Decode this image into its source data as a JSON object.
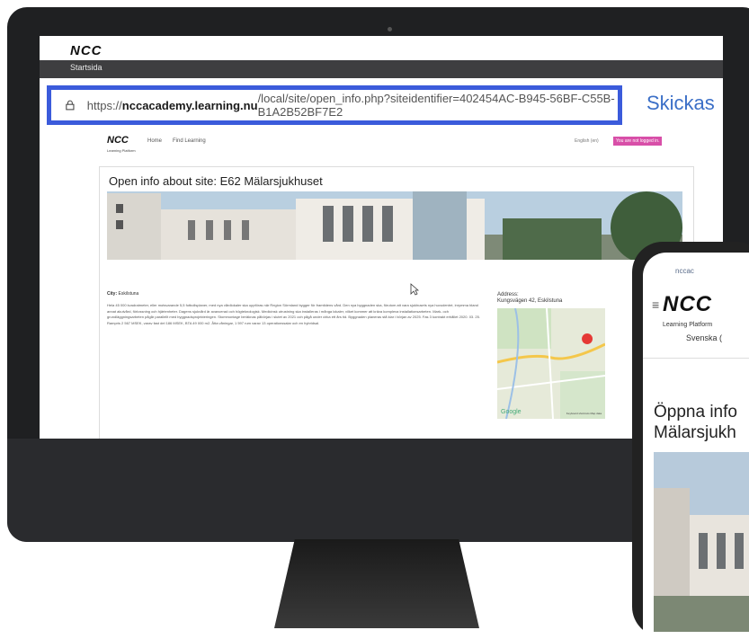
{
  "monitor": {
    "topbar": {
      "logo": "NCC",
      "home_label": "Startsida"
    },
    "url": {
      "prefix": "https://",
      "domain": "nccacademy.learning.nu",
      "path": "/local/site/open_info.php?siteidentifier=402454AC-B945-56BF-C55B-B1A2B52BF7E2"
    },
    "skickas": "Skickas",
    "site_header": {
      "logo": "NCC",
      "logo_sub": "Learning Platform",
      "nav": [
        "Home",
        "Find Learning"
      ],
      "language": "English (en)",
      "login_status": "You are not logged in."
    },
    "page": {
      "title": "Open info about site: E62 Mälarsjukhuset",
      "city_label": "City:",
      "city_value": "Eskilstuna",
      "description": "Hela 45 000 kvadratmeter, eller motsvarande 5,5 fotbollsplaner, med nya vårdlokaler ska uppföras när Region Sörmland bygger för framtidens vård. Den nya byggnaden ska, förutom att vara sjukhusets nya huvudentré, inrymma bland annat akutvård, förlossning och hjärtenheter. Dagens sjukvård är avancerad och högteknologisk. Medicinsk utrustning ska installeras i många lokaler, vilket kommer att kräva komplexa installationsarbeten. Mark- och grundläggningsarbeten pågår parallellt med byggnadsprojekteringen. Stommontage beräknas påbörjas i slutet av 2021 och pågå under cirka ett års tid. Byggnaden planeras stå klar i början av 2025. Fas 3 kontrakt erhållet 2020. 03. 25. Rampris 2 567 MSEK, varav fast del 186 MSEK, BTA 49 000 m2. Åtta våningar, 1 597 rum varav 13 operationssalar och en hybridsal.",
      "address_label": "Address:",
      "address_value": "Kungsvägen 42, Eskilstuna",
      "map_brand": "Google",
      "map_note": "Keyboard shortcuts   Map data"
    }
  },
  "phone": {
    "url": "nccac",
    "logo": "NCC",
    "logo_sub": "Learning Platform",
    "language": "Svenska (",
    "title_line1": "Öppna info",
    "title_line2": "Mälarsjukh"
  },
  "colors": {
    "highlight_border": "#3b5bdb",
    "skickas": "#3b6fc7",
    "login_badge": "#d84fa8",
    "dark_bar": "#3e3e40"
  }
}
